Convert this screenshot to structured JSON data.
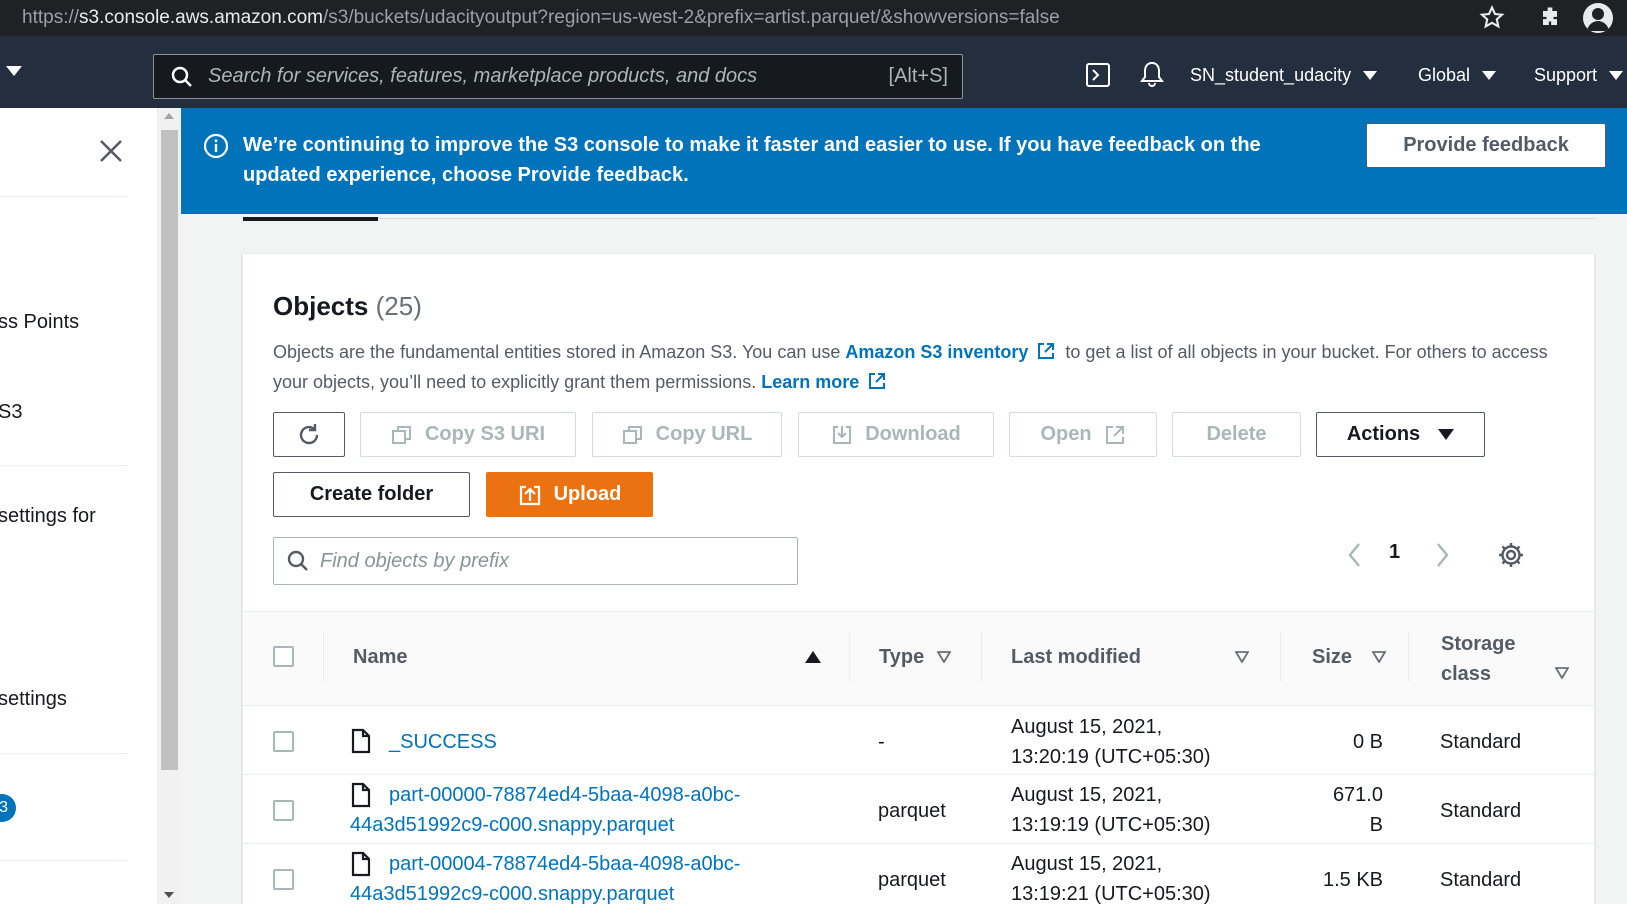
{
  "browser": {
    "url_prefix": "https://",
    "url_host": "s3.console.aws.amazon.com",
    "url_path": "/s3/buckets/udacityoutput?region=us-west-2&prefix=artist.parquet/&showversions=false"
  },
  "aws_nav": {
    "search_placeholder": "Search for services, features, marketplace products, and docs",
    "search_shortcut": "[Alt+S]",
    "account": "SN_student_udacity",
    "region": "Global",
    "support": "Support"
  },
  "sidebar": {
    "items": [
      "ss Points",
      "S3",
      "settings for",
      "settings"
    ],
    "badge": "3"
  },
  "banner": {
    "text_main": "We’re continuing to improve the S3 console to make it faster and easier to use. If you have feedback on the updated experience, choose ",
    "text_bold": "Provide feedback",
    "text_end": ".",
    "button": "Provide feedback"
  },
  "objects": {
    "title": "Objects",
    "count": "(25)",
    "desc_1": "Objects are the fundamental entities stored in Amazon S3. You can use ",
    "link_inventory": "Amazon S3 inventory",
    "desc_2": " to get a list of all objects in your bucket. For others to access your objects, you’ll need to explicitly grant them permissions. ",
    "link_learn": "Learn more"
  },
  "toolbar": {
    "copy_s3_uri": "Copy S3 URI",
    "copy_url": "Copy URL",
    "download": "Download",
    "open": "Open",
    "delete": "Delete",
    "actions": "Actions",
    "create_folder": "Create folder",
    "upload": "Upload"
  },
  "find": {
    "placeholder": "Find objects by prefix"
  },
  "pagination": {
    "page": "1"
  },
  "table": {
    "headers": {
      "name": "Name",
      "type": "Type",
      "last_modified": "Last modified",
      "size": "Size",
      "storage_line1": "Storage",
      "storage_line2": "class"
    },
    "rows": [
      {
        "name_line1": "_SUCCESS",
        "name_line2": "",
        "type": "-",
        "modified_line1": "August 15, 2021,",
        "modified_line2": "13:20:19 (UTC+05:30)",
        "size_line1": "0 B",
        "size_line2": "",
        "storage": "Standard"
      },
      {
        "name_line1": "part-00000-78874ed4-5baa-4098-a0bc-",
        "name_line2": "44a3d51992c9-c000.snappy.parquet",
        "type": "parquet",
        "modified_line1": "August 15, 2021,",
        "modified_line2": "13:19:19 (UTC+05:30)",
        "size_line1": "671.0",
        "size_line2": "B",
        "storage": "Standard"
      },
      {
        "name_line1": "part-00004-78874ed4-5baa-4098-a0bc-",
        "name_line2": "44a3d51992c9-c000.snappy.parquet",
        "type": "parquet",
        "modified_line1": "August 15, 2021,",
        "modified_line2": "13:19:21 (UTC+05:30)",
        "size_line1": "1.5 KB",
        "size_line2": "",
        "storage": "Standard"
      }
    ]
  },
  "colors": {
    "nav_bg": "#232f3e",
    "banner_bg": "#0073bb",
    "link": "#0073bb",
    "primary": "#ec7211"
  }
}
